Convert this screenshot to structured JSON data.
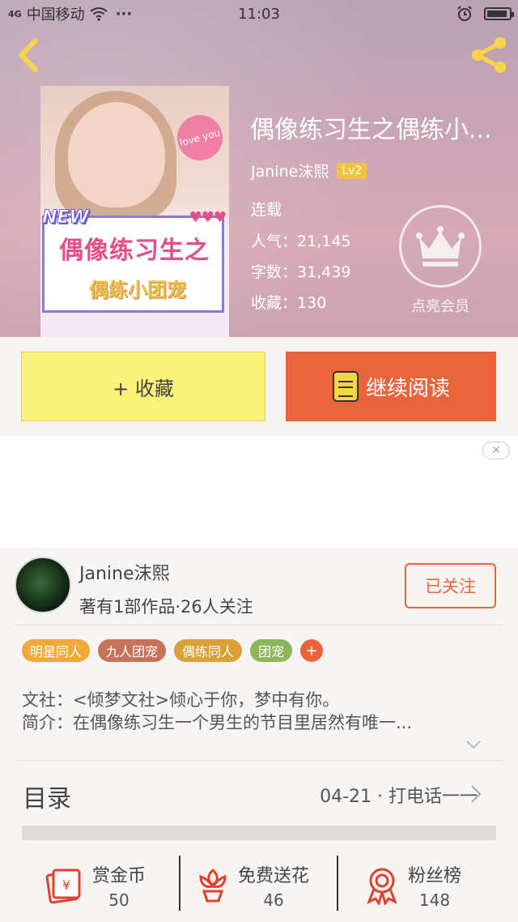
{
  "status_bar": {
    "signal": "4G",
    "carrier": "中国移动",
    "dots": "···",
    "time": "11:03"
  },
  "book": {
    "title": "偶像练习生之偶练小...",
    "author": "Janine沫熙",
    "level": "Lv2",
    "status": "连载",
    "popularity_label": "人气：",
    "popularity": "21,145",
    "words_label": "字数：",
    "words": "31,439",
    "favorites_label": "收藏：",
    "favorites": "130",
    "vip_label": "点亮会员",
    "cover": {
      "badge_new": "NEW",
      "line1": "偶像练习生之",
      "line2": "偶练小团宠",
      "heart_text": "love you",
      "hearts": "♥♥♥"
    }
  },
  "buttons": {
    "favorite": "+ 收藏",
    "continue_reading": "继续阅读",
    "ad_close": "✕"
  },
  "author_card": {
    "name": "Janine沫熙",
    "info": "著有1部作品·26人关注",
    "follow": "已关注"
  },
  "tags": [
    {
      "label": "明星同人",
      "color": "#f2a93b"
    },
    {
      "label": "九人团宠",
      "color": "#c9725a"
    },
    {
      "label": "偶练同人",
      "color": "#d9a03a"
    },
    {
      "label": "团宠",
      "color": "#8fb55a"
    }
  ],
  "tag_add": "+",
  "description": {
    "society": "文社：<倾梦文社>倾心于你，梦中有你。",
    "intro": "简介：在偶像练习生一个男生的节目里居然有唯一..."
  },
  "toc": {
    "title": "目录",
    "latest": "04-21 · 打电话一一"
  },
  "actions": [
    {
      "label": "赏金币",
      "count": "50",
      "icon": "coin-envelope-icon"
    },
    {
      "label": "免费送花",
      "count": "46",
      "icon": "flower-icon"
    },
    {
      "label": "粉丝榜",
      "count": "148",
      "icon": "ribbon-icon"
    }
  ],
  "colors": {
    "accent": "#e8653b",
    "favorite_button": "#fbf27c",
    "level_badge": "#f4c33b",
    "icon_yellow": "#f7d54a",
    "icon_red": "#e0402e"
  }
}
